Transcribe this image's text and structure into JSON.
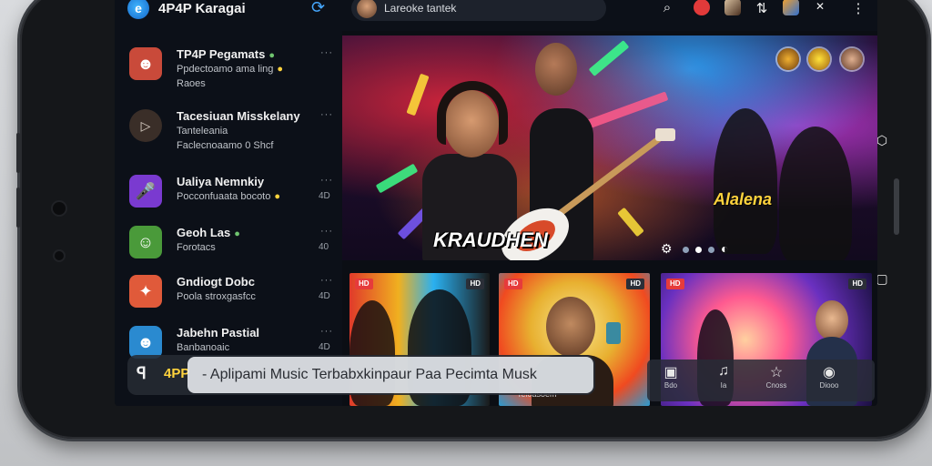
{
  "app": {
    "title": "4P4P Karagai"
  },
  "sidebar": {
    "items": [
      {
        "name": "TP4P Pegamats",
        "sub1": "Ppdectoamo ama ling",
        "sub2": "Raoes",
        "meta": "···",
        "avatar_color": "#c94a3a"
      },
      {
        "name": "Tacesiuan Misskelany",
        "sub1": "Tanteleania",
        "sub2": "Faclecnoaamo 0 Shcf",
        "meta": "···",
        "avatar_color": "#3a2e28"
      },
      {
        "name": "Ualiya Nemnkiy",
        "sub1": "Pocconfuaata bocoto",
        "sub2": "",
        "meta": "···",
        "mark": "4D",
        "avatar_color": "#7a3ad0"
      },
      {
        "name": "Geoh Las",
        "sub1": "Forotacs",
        "sub2": "",
        "meta": "···",
        "mark": "40",
        "avatar_color": "#4a9a3a"
      },
      {
        "name": "Gndiogt Dobc",
        "sub1": "Poola stroxgasfcc",
        "sub2": "",
        "meta": "···",
        "mark": "4D",
        "avatar_color": "#e05a3a"
      },
      {
        "name": "Jabehn Pastial",
        "sub1": "Banbanoaic",
        "sub2": "",
        "meta": "···",
        "mark": "4D",
        "avatar_color": "#2a8ad0"
      }
    ]
  },
  "search": {
    "text": "Lareoke tantek"
  },
  "hero": {
    "title": "KRAUDHEN",
    "tagline": "Alalena"
  },
  "cards": [
    {
      "caption": "",
      "badge_left": "HD",
      "badge_right": "HD"
    },
    {
      "caption": "Teloasoem",
      "badge_left": "HD",
      "badge_right": "HD"
    },
    {
      "caption": "",
      "badge_left": "HD",
      "badge_right": "HD"
    }
  ],
  "banner": {
    "logo": "ꟼ",
    "brand": "4PP",
    "text": "- Aplipami Music Terbabxkinpaur Paa Pecimta Musk"
  },
  "bottom_nav": [
    {
      "label": "Bdo",
      "icon": "home-icon"
    },
    {
      "label": "Ia",
      "icon": "music-icon"
    },
    {
      "label": "Cnoss",
      "icon": "star-icon"
    },
    {
      "label": "Diooo",
      "icon": "settings-icon"
    }
  ],
  "colors": {
    "accent": "#46a8ff",
    "brand_yellow": "#ffd33d",
    "background": "#0b0e14"
  }
}
